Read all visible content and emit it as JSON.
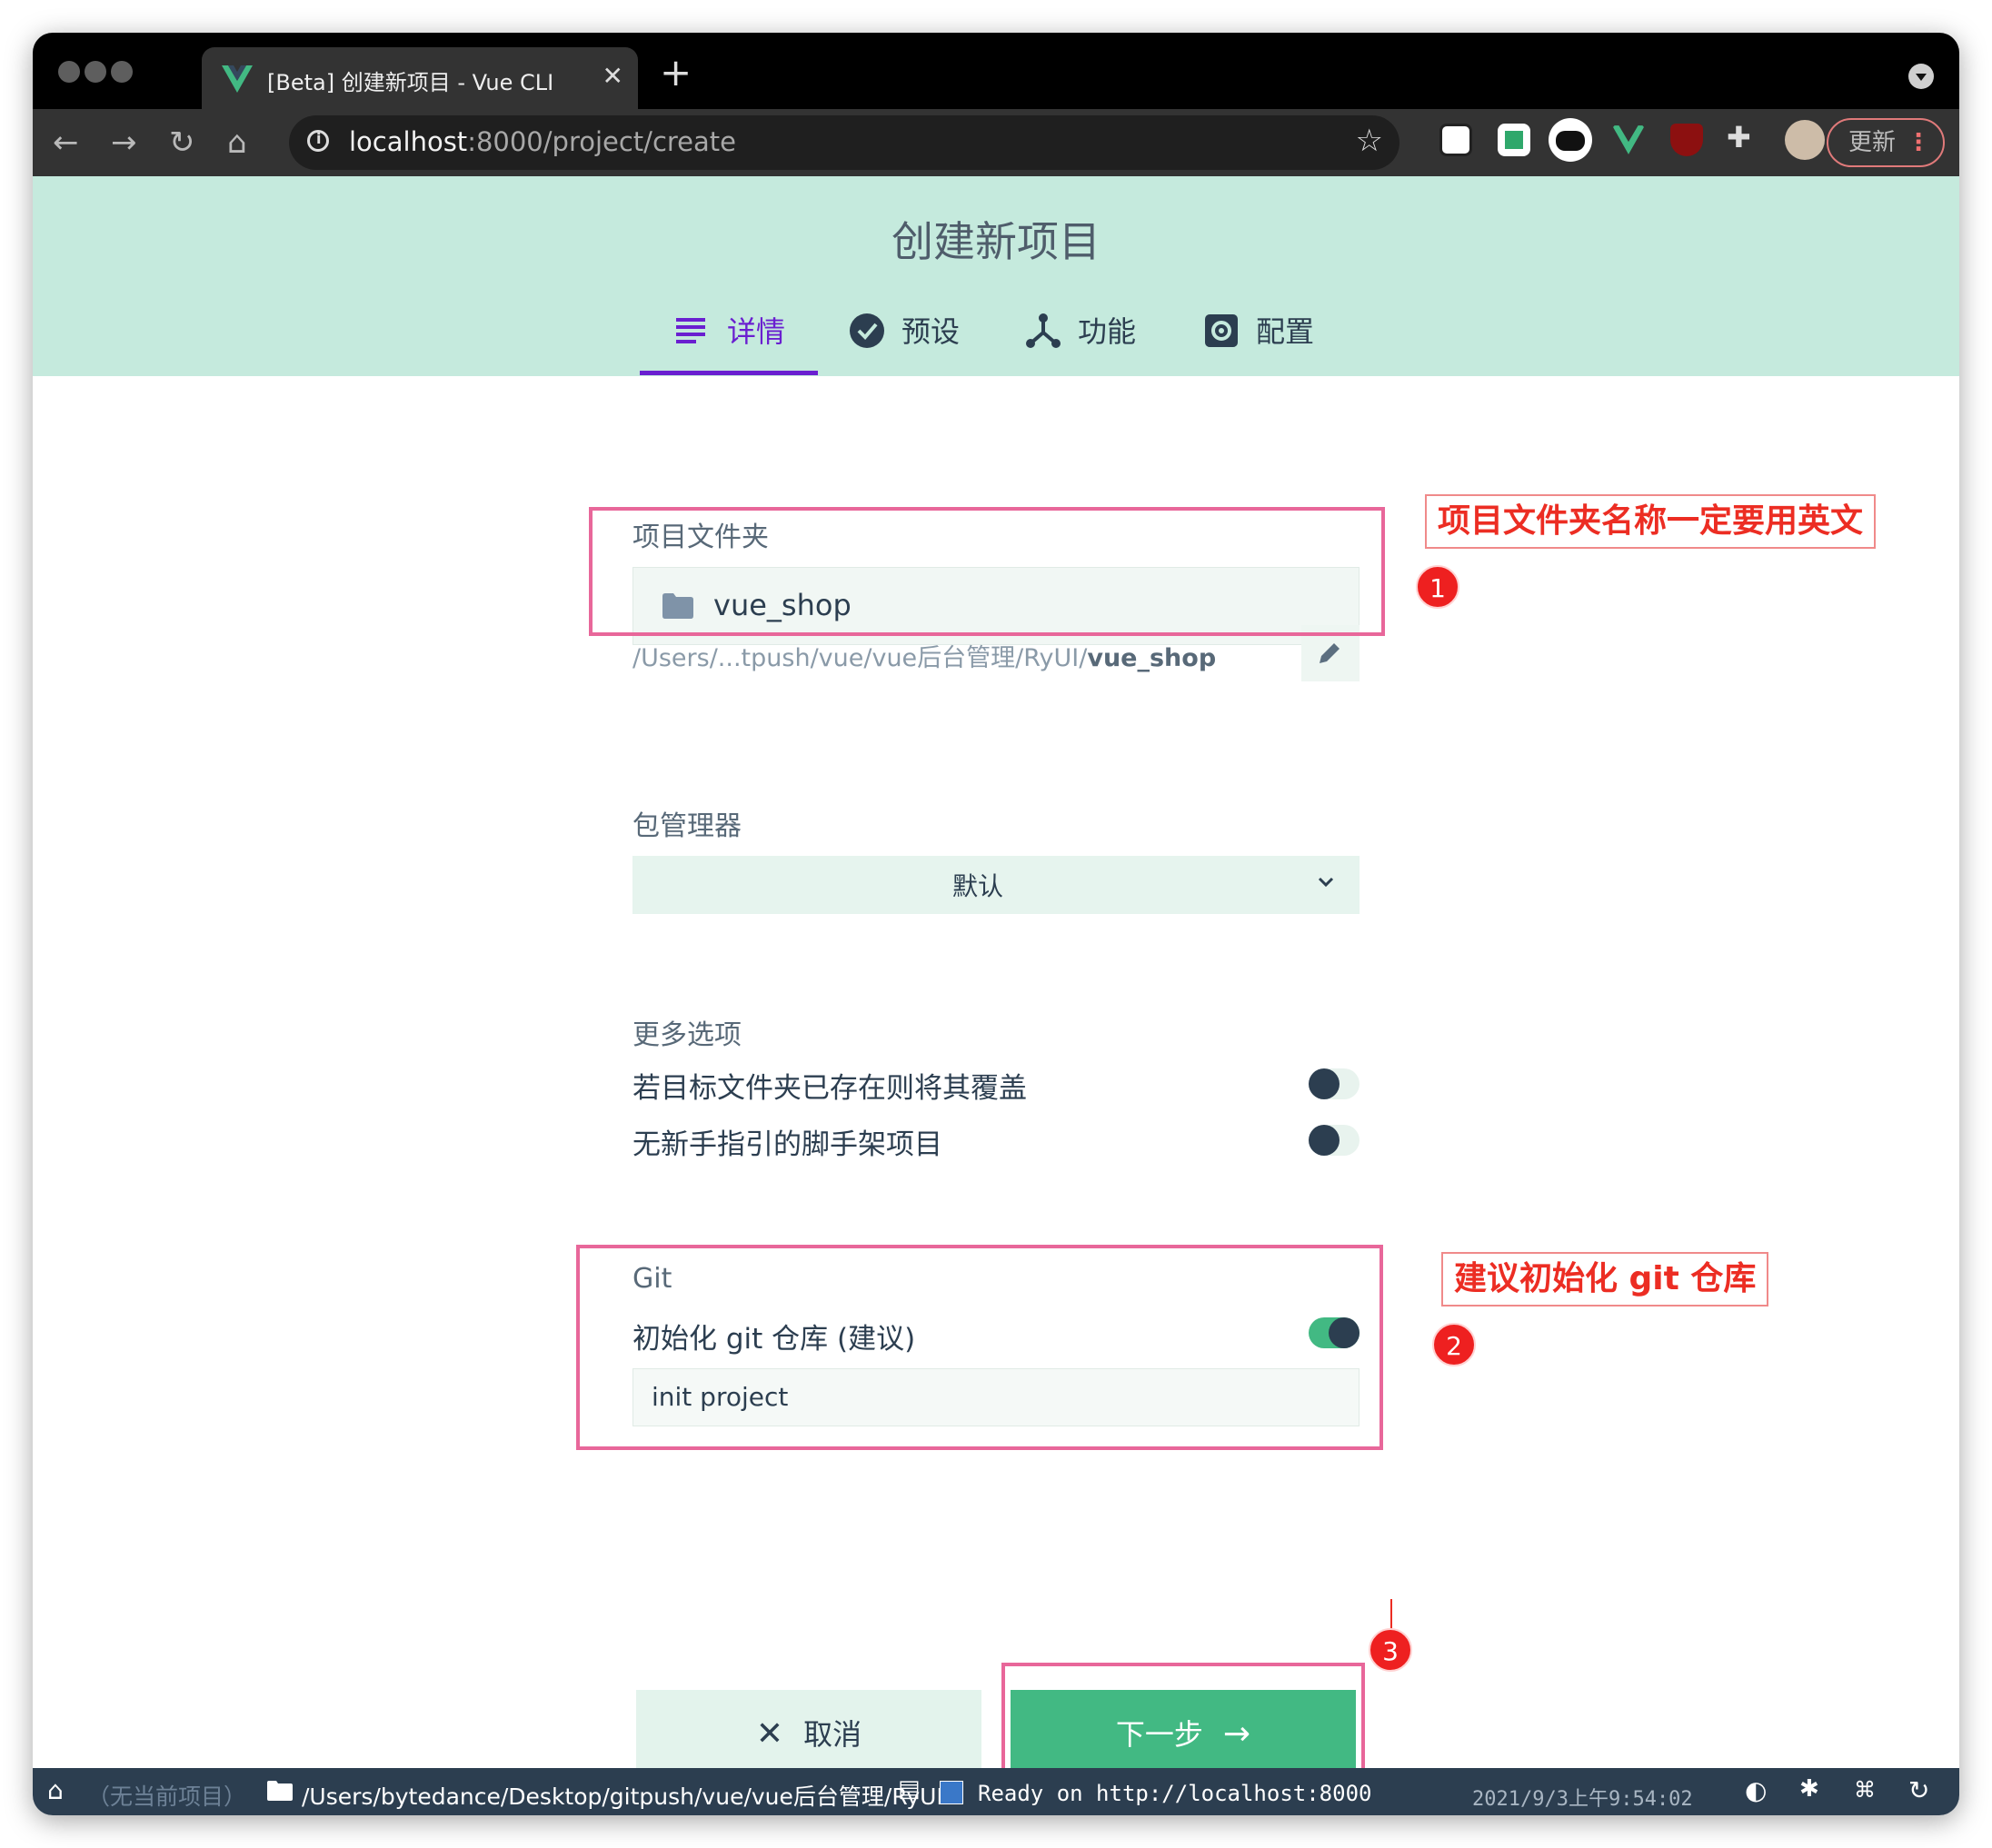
{
  "browser": {
    "tab_title": "[Beta] 创建新项目 - Vue CLI",
    "url_host": "localhost",
    "url_rest": ":8000/project/create",
    "update_label": "更新",
    "extensions": [
      "notion-icon",
      "pocket-icon",
      "ghost-icon",
      "vue-devtools-icon",
      "ublock-icon",
      "puzzle-icon",
      "profile-avatar"
    ]
  },
  "header": {
    "title": "创建新项目",
    "tabs": [
      {
        "label": "详情",
        "icon": "list-icon",
        "active": true
      },
      {
        "label": "预设",
        "icon": "check-circle-icon",
        "active": false
      },
      {
        "label": "功能",
        "icon": "fork-icon",
        "active": false
      },
      {
        "label": "配置",
        "icon": "settings-icon",
        "active": false
      }
    ]
  },
  "form": {
    "folder_label": "项目文件夹",
    "folder_value": "vue_shop",
    "path_prefix": "/Users/...tpush/vue/vue后台管理/RyUI/",
    "path_name": "vue_shop",
    "package_manager_label": "包管理器",
    "package_manager_value": "默认",
    "more_options_label": "更多选项",
    "options": [
      {
        "label": "若目标文件夹已存在则将其覆盖",
        "enabled": false
      },
      {
        "label": "无新手指引的脚手架项目",
        "enabled": false
      }
    ],
    "git_label": "Git",
    "git_init_label": "初始化 git 仓库 (建议)",
    "git_init_enabled": true,
    "commit_message": "init project",
    "cancel_label": "取消",
    "next_label": "下一步"
  },
  "annotations": {
    "note1": "项目文件夹名称一定要用英文",
    "note2": "建议初始化 git 仓库",
    "num1": "1",
    "num2": "2",
    "num3": "3",
    "color": "#ec2d23"
  },
  "statusbar": {
    "project": "（无当前项目）",
    "cwd": "/Users/bytedance/Desktop/gitpush/vue/vue后台管理/RyUI",
    "log": "Ready on http://localhost:8000",
    "datetime": "2021/9/3上午9:54:02"
  },
  "colors": {
    "vue_green": "#42b983",
    "accent_purple": "#6a1fd0",
    "header_bg": "#c5eadd",
    "annotation_pink": "#e8679a"
  }
}
